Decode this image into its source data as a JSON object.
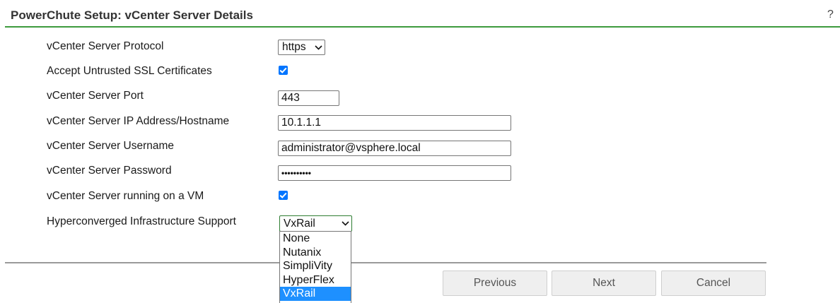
{
  "page": {
    "title": "PowerChute Setup: vCenter Server Details",
    "help": "?"
  },
  "form": {
    "protocol": {
      "label": "vCenter Server Protocol",
      "value": "https"
    },
    "accept_untrusted": {
      "label": "Accept Untrusted SSL Certificates",
      "checked": true
    },
    "port": {
      "label": "vCenter Server Port",
      "value": "443"
    },
    "host": {
      "label": "vCenter Server IP Address/Hostname",
      "value": "10.1.1.1"
    },
    "username": {
      "label": "vCenter Server Username",
      "value": "administrator@vsphere.local"
    },
    "password": {
      "label": "vCenter Server Password",
      "value": "••••••••••"
    },
    "running_on_vm": {
      "label": "vCenter Server running on a VM",
      "checked": true
    },
    "hci": {
      "label": "Hyperconverged Infrastructure Support",
      "value": "VxRail",
      "options": [
        "None",
        "Nutanix",
        "SimpliVity",
        "HyperFlex",
        "VxRail"
      ],
      "expanded": true
    }
  },
  "buttons": {
    "previous": "Previous",
    "next": "Next",
    "cancel": "Cancel"
  },
  "colors": {
    "accent": "#3d9a3d",
    "checkbox": "#0075ff",
    "selected_option": "#1e90ff",
    "focus_border": "#2e7d32"
  }
}
